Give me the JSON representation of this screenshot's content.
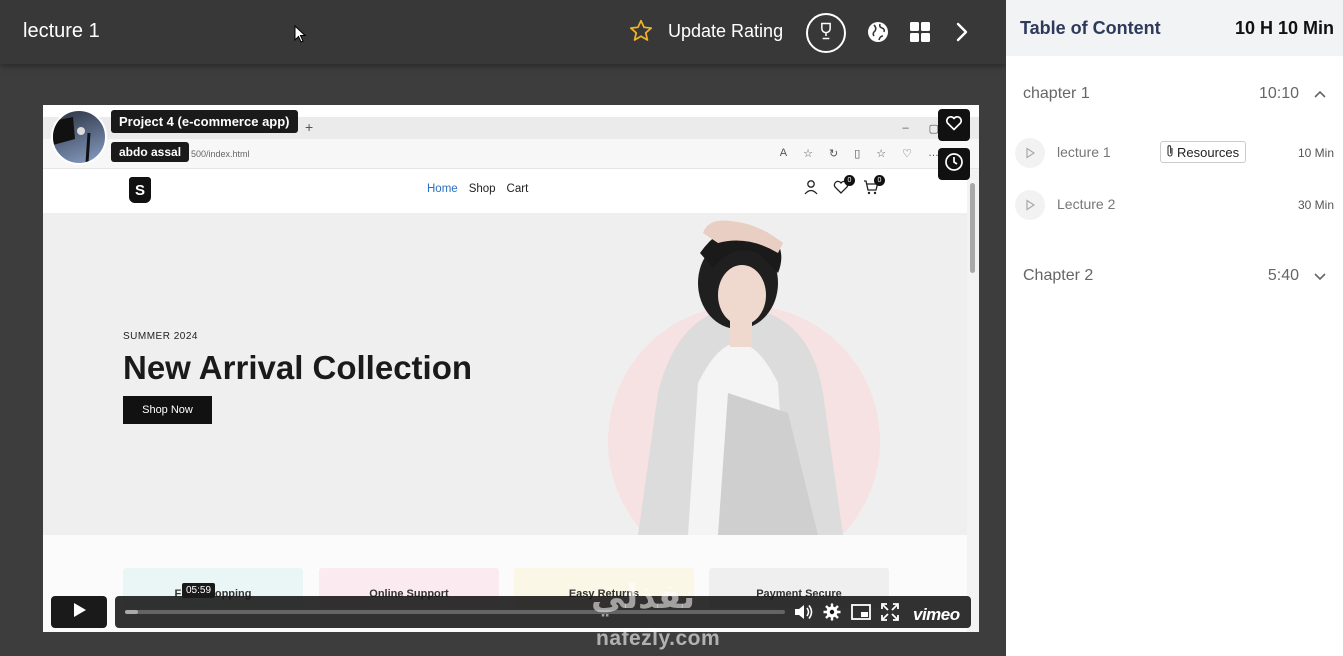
{
  "header": {
    "lecture_title": "lecture 1",
    "rating_label": "Update Rating",
    "icons": {
      "rating": "star-icon",
      "achievements": "trophy-icon",
      "language": "globe-icon",
      "apps": "grid-icon",
      "next": "chevron-right-icon"
    }
  },
  "video": {
    "presenter": {
      "course_title": "Project 4 (e-commerce app)",
      "name": "abdo assal"
    },
    "browser": {
      "url": "500/index.html"
    },
    "site": {
      "nav": [
        "Home",
        "Shop",
        "Cart"
      ],
      "wishlist_count": "0",
      "cart_count": "0",
      "hero_subtitle": "SUMMER 2024",
      "hero_title": "New Arrival Collection",
      "hero_button": "Shop Now",
      "features": [
        "Free Shopping",
        "Online Support",
        "Easy Returns",
        "Payment Secure"
      ]
    },
    "player": {
      "current_time": "05:59",
      "progress": 0.02,
      "brand": "vimeo"
    }
  },
  "watermark": {
    "arabic": "نفذلي",
    "latin": "nafezly.com"
  },
  "toc": {
    "title": "Table of Content",
    "total_duration": "10 H 10 Min",
    "chapters": [
      {
        "name": "chapter 1",
        "duration": "10:10",
        "expanded": true,
        "lectures": [
          {
            "name": "lecture 1",
            "duration": "10 Min",
            "resources_label": "Resources"
          },
          {
            "name": "Lecture 2",
            "duration": "30 Min"
          }
        ]
      },
      {
        "name": "Chapter 2",
        "duration": "5:40",
        "expanded": false
      }
    ]
  },
  "colors": {
    "accent": "#2e3a5c",
    "star": "#f0b429",
    "topbar": "#383838"
  }
}
